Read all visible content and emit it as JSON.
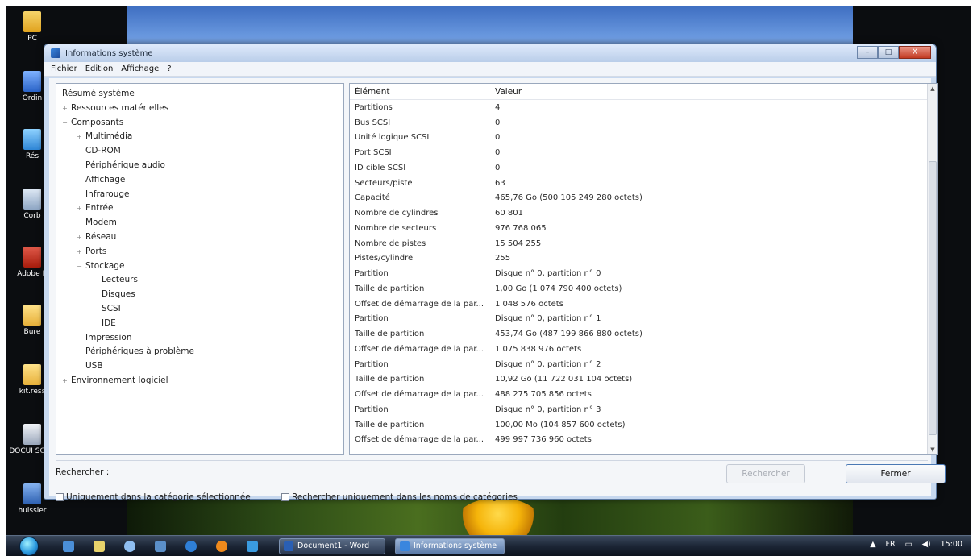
{
  "desktop": {
    "icons": [
      {
        "label": "PC"
      },
      {
        "label": "Ordin"
      },
      {
        "label": "Rés"
      },
      {
        "label": "Corb"
      },
      {
        "label": "Adobe R"
      },
      {
        "label": "Bure"
      },
      {
        "label": "kit.ress"
      },
      {
        "label": "DOCUI SCAN"
      },
      {
        "label": "huissier"
      }
    ]
  },
  "window": {
    "title": "Informations système",
    "controls": {
      "minimize": "–",
      "maximize": "□",
      "close": "X"
    },
    "menu": [
      "Fichier",
      "Edition",
      "Affichage",
      "?"
    ]
  },
  "tree": {
    "items": [
      {
        "label": "Résumé système",
        "level": 0,
        "expander": ""
      },
      {
        "label": "Ressources matérielles",
        "level": 1,
        "expander": "+"
      },
      {
        "label": "Composants",
        "level": 1,
        "expander": "−"
      },
      {
        "label": "Multimédia",
        "level": 2,
        "expander": "+"
      },
      {
        "label": "CD-ROM",
        "level": 2,
        "expander": ""
      },
      {
        "label": "Périphérique audio",
        "level": 2,
        "expander": ""
      },
      {
        "label": "Affichage",
        "level": 2,
        "expander": ""
      },
      {
        "label": "Infrarouge",
        "level": 2,
        "expander": ""
      },
      {
        "label": "Entrée",
        "level": 2,
        "expander": "+"
      },
      {
        "label": "Modem",
        "level": 2,
        "expander": ""
      },
      {
        "label": "Réseau",
        "level": 2,
        "expander": "+"
      },
      {
        "label": "Ports",
        "level": 2,
        "expander": "+"
      },
      {
        "label": "Stockage",
        "level": 2,
        "expander": "−"
      },
      {
        "label": "Lecteurs",
        "level": 3,
        "expander": ""
      },
      {
        "label": "Disques",
        "level": 3,
        "expander": ""
      },
      {
        "label": "SCSI",
        "level": 3,
        "expander": ""
      },
      {
        "label": "IDE",
        "level": 3,
        "expander": ""
      },
      {
        "label": "Impression",
        "level": 2,
        "expander": ""
      },
      {
        "label": "Périphériques à problème",
        "level": 2,
        "expander": ""
      },
      {
        "label": "USB",
        "level": 2,
        "expander": ""
      },
      {
        "label": "Environnement logiciel",
        "level": 1,
        "expander": "+"
      }
    ]
  },
  "details": {
    "columns": {
      "element": "Élément",
      "value": "Valeur"
    },
    "rows": [
      {
        "element": "Partitions",
        "value": "4"
      },
      {
        "element": "Bus SCSI",
        "value": "0"
      },
      {
        "element": "Unité logique SCSI",
        "value": "0"
      },
      {
        "element": "Port SCSI",
        "value": "0"
      },
      {
        "element": "ID cible SCSI",
        "value": "0"
      },
      {
        "element": "Secteurs/piste",
        "value": "63"
      },
      {
        "element": "Capacité",
        "value": "465,76 Go (500 105 249 280 octets)"
      },
      {
        "element": "Nombre de cylindres",
        "value": "60 801"
      },
      {
        "element": "Nombre de secteurs",
        "value": "976 768 065"
      },
      {
        "element": "Nombre de pistes",
        "value": "15 504 255"
      },
      {
        "element": "Pistes/cylindre",
        "value": "255"
      },
      {
        "element": "Partition",
        "value": "Disque n° 0, partition n° 0"
      },
      {
        "element": "Taille de partition",
        "value": "1,00 Go (1 074 790 400 octets)"
      },
      {
        "element": "Offset de démarrage de la par...",
        "value": "1 048 576 octets"
      },
      {
        "element": "Partition",
        "value": "Disque n° 0, partition n° 1"
      },
      {
        "element": "Taille de partition",
        "value": "453,74 Go (487 199 866 880 octets)"
      },
      {
        "element": "Offset de démarrage de la par...",
        "value": "1 075 838 976 octets"
      },
      {
        "element": "Partition",
        "value": "Disque n° 0, partition n° 2"
      },
      {
        "element": "Taille de partition",
        "value": "10,92 Go (11 722 031 104 octets)"
      },
      {
        "element": "Offset de démarrage de la par...",
        "value": "488 275 705 856 octets"
      },
      {
        "element": "Partition",
        "value": "Disque n° 0, partition n° 3"
      },
      {
        "element": "Taille de partition",
        "value": "100,00 Mo (104 857 600 octets)"
      },
      {
        "element": "Offset de démarrage de la par...",
        "value": "499 997 736 960 octets"
      }
    ]
  },
  "search": {
    "label": "Rechercher :",
    "value": "",
    "search_button": "Rechercher",
    "close_button": "Fermer",
    "option_selected_category": "Uniquement dans la catégorie sélectionnée",
    "option_category_names": "Rechercher uniquement dans les noms de catégories"
  },
  "taskbar": {
    "tasks": [
      {
        "label": "Document1 - Word"
      },
      {
        "label": "Informations système"
      }
    ],
    "tray_lang": "FR",
    "clock": "15:00"
  }
}
